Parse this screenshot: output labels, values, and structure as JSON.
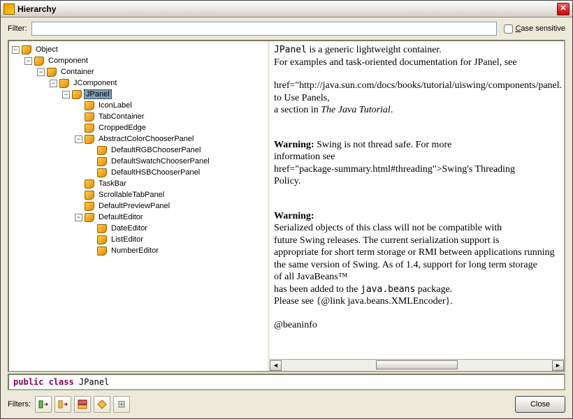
{
  "window": {
    "title": "Hierarchy"
  },
  "filter": {
    "label": "Filter:",
    "value": "",
    "case_label_pre": "",
    "case_label_u": "C",
    "case_label_post": "ase sensitive"
  },
  "tree": {
    "n0": "Object",
    "n1": "Component",
    "n2": "Container",
    "n3": "JComponent",
    "n4": "JPanel",
    "n5": "IconLabel",
    "n6": "TabContainer",
    "n7": "CroppedEdge",
    "n8": "AbstractColorChooserPanel",
    "n9": "DefaultRGBChooserPanel",
    "n10": "DefaultSwatchChooserPanel",
    "n11": "DefaultHSBChooserPanel",
    "n12": "TaskBar",
    "n13": "ScrollableTabPanel",
    "n14": "DefaultPreviewPanel",
    "n15": "DefaultEditor",
    "n16": "DateEditor",
    "n17": "ListEditor",
    "n18": "NumberEditor"
  },
  "doc": {
    "l1a": "JPanel",
    "l1b": " is a generic lightweight container.",
    "l2": "For examples and task-oriented documentation for JPanel, see",
    "l3": "href=\"http://java.sun.com/docs/books/tutorial/uiswing/components/panel.",
    "l4": " to Use Panels,",
    "l5a": "a section in ",
    "l5b": "The Java Tutorial",
    "l5c": ".",
    "w1": "Warning:",
    "w1b": " Swing is not thread safe. For more",
    "w2": "information see",
    "w3": "href=\"package-summary.html#threading\">Swing's Threading",
    "w4": "Policy.",
    "w5": "Warning:",
    "s1": "Serialized objects of this class will not be compatible with",
    "s2": "future Swing releases. The current serialization support is",
    "s3": "appropriate for short term storage or RMI between applications running",
    "s4": "the same version of Swing. As of 1.4, support for long term storage",
    "s5": "of all JavaBeans™",
    "s6a": "has been added to the ",
    "s6b": "java.beans",
    "s6c": " package.",
    "s7": "Please see {@link java.beans.XMLEncoder}.",
    "s8": "@beaninfo"
  },
  "signature": {
    "kw": "public class ",
    "name": "JPanel"
  },
  "bottom": {
    "filters_label": "Filters:",
    "close": "Close"
  }
}
